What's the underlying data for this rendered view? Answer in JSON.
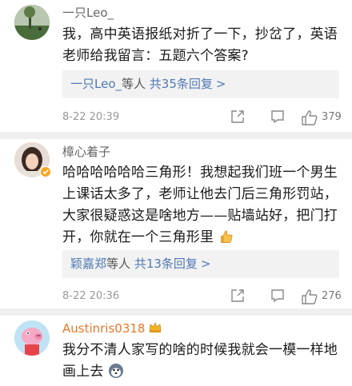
{
  "comments": [
    {
      "username": "一只Leo_",
      "text": "我，高中英语报纸对折了一下，抄岔了，英语老师给我留言：五题六个答案?",
      "reply_user": "一只Leo_",
      "reply_mid": "等人",
      "reply_count": "共35条回复",
      "reply_arrow": ">",
      "time": "8-22 20:39",
      "likes": "379"
    },
    {
      "username": "樟心着子",
      "text": "哈哈哈哈哈哈三角形！我想起我们班一个男生上课话太多了，老师让他去门后三角形罚站，大家很疑惑这是啥地方——贴墙站好，把门打开，你就在一个三角形里",
      "reply_user": "颖嘉郑",
      "reply_mid": "等人",
      "reply_count": "共13条回复",
      "reply_arrow": ">",
      "time": "8-22 20:36",
      "likes": "276"
    },
    {
      "username": "Austinris0318",
      "text": "我分不清人家写的啥的时候我就会一模一样地画上去"
    }
  ],
  "colors": {
    "link": "#4f79b4",
    "meta": "#999999",
    "username_highlight": "#e8782a"
  }
}
